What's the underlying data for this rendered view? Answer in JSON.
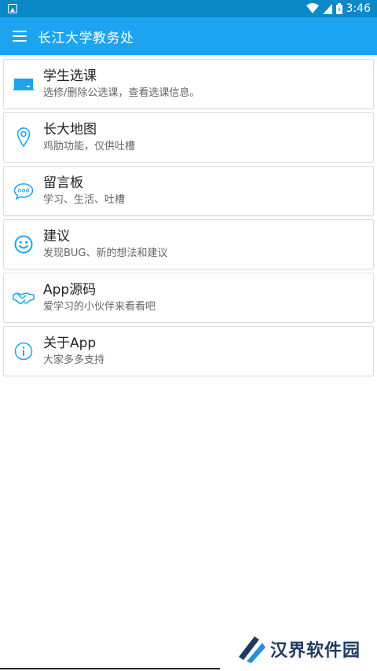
{
  "status_bar": {
    "time": "3:46"
  },
  "app_bar": {
    "title": "长江大学教务处"
  },
  "menu": [
    {
      "title": "学生选课",
      "subtitle": "选修/删除公选课，查看选课信息。",
      "icon": "board-icon"
    },
    {
      "title": "长大地图",
      "subtitle": "鸡肋功能，仅供吐槽",
      "icon": "location-pin-icon"
    },
    {
      "title": "留言板",
      "subtitle": "学习、生活、吐槽",
      "icon": "chat-bubble-icon"
    },
    {
      "title": "建议",
      "subtitle": "发现BUG、新的想法和建议",
      "icon": "smiley-icon"
    },
    {
      "title": "App源码",
      "subtitle": "爱学习的小伙伴来看看吧",
      "icon": "handshake-icon"
    },
    {
      "title": "关于App",
      "subtitle": "大家多多支持",
      "icon": "info-icon"
    }
  ],
  "watermark": {
    "text": "汉界软件园"
  },
  "colors": {
    "status_bar": "#0b88c6",
    "app_bar": "#1ca4f0",
    "icon_blue": "#1ca4f0"
  }
}
